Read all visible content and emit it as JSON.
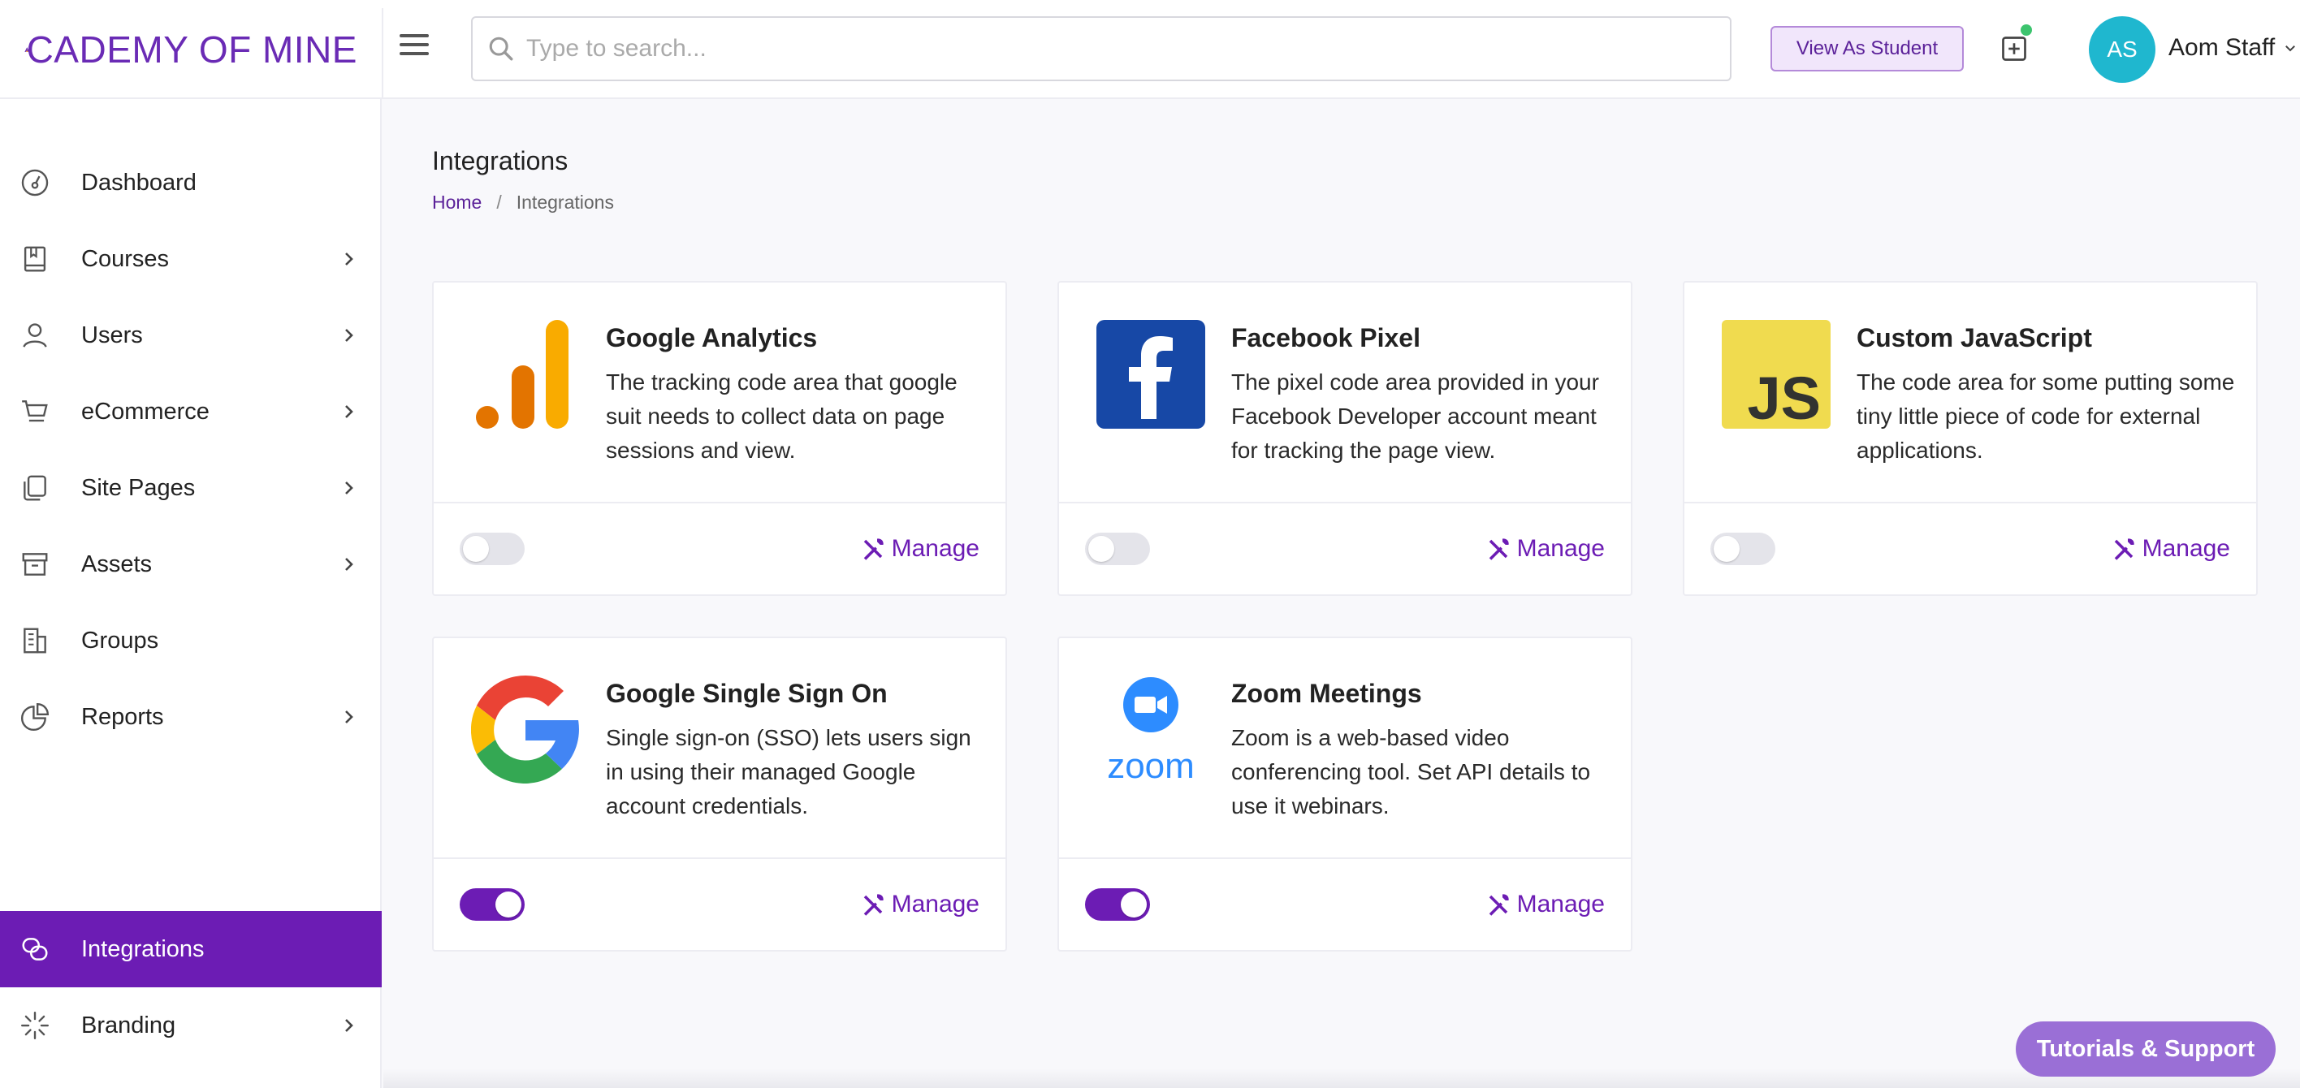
{
  "header": {
    "logo_text": "CADEMY OF MINE",
    "search_placeholder": "Type to search...",
    "view_as_student": "View As Student",
    "user_initials": "AS",
    "user_name": "Aom Staff"
  },
  "sidebar": {
    "items": [
      {
        "label": "Dashboard",
        "icon": "dashboard-icon",
        "has_submenu": false
      },
      {
        "label": "Courses",
        "icon": "book-icon",
        "has_submenu": true
      },
      {
        "label": "Users",
        "icon": "user-icon",
        "has_submenu": true
      },
      {
        "label": "eCommerce",
        "icon": "cart-icon",
        "has_submenu": true
      },
      {
        "label": "Site Pages",
        "icon": "pages-icon",
        "has_submenu": true
      },
      {
        "label": "Assets",
        "icon": "archive-icon",
        "has_submenu": true
      },
      {
        "label": "Groups",
        "icon": "building-icon",
        "has_submenu": false
      },
      {
        "label": "Reports",
        "icon": "pie-chart-icon",
        "has_submenu": true
      },
      {
        "label": "Integrations",
        "icon": "integrations-icon",
        "has_submenu": false,
        "active": true
      },
      {
        "label": "Branding",
        "icon": "sparkle-icon",
        "has_submenu": true
      }
    ]
  },
  "page": {
    "title": "Integrations",
    "breadcrumb": {
      "home": "Home",
      "separator": "/",
      "current": "Integrations"
    }
  },
  "cards": [
    {
      "title": "Google Analytics",
      "description": "The tracking code area that google suit needs to collect data on page sessions and view.",
      "enabled": false,
      "manage_label": "Manage",
      "icon": "google-analytics-icon"
    },
    {
      "title": "Facebook Pixel",
      "description": "The pixel code area provided in your Facebook Developer account meant for tracking the page view.",
      "enabled": false,
      "manage_label": "Manage",
      "icon": "facebook-icon"
    },
    {
      "title": "Custom JavaScript",
      "description": "The code area for some putting some tiny little piece of code for external applications.",
      "enabled": false,
      "manage_label": "Manage",
      "icon": "javascript-icon",
      "logo_text": "JS"
    },
    {
      "title": "Google Single Sign On",
      "description": "Single sign-on (SSO) lets users sign in using their managed Google account credentials.",
      "enabled": true,
      "manage_label": "Manage",
      "icon": "google-icon"
    },
    {
      "title": "Zoom Meetings",
      "description": "Zoom is a web-based video conferencing tool. Set API details to use it webinars.",
      "enabled": true,
      "manage_label": "Manage",
      "icon": "zoom-icon",
      "logo_text": "zoom"
    }
  ],
  "tutorials_label": "Tutorials & Support",
  "colors": {
    "accent": "#6c1cb4",
    "avatar": "#1fb7cf",
    "toggle_off": "#e4e4ea"
  }
}
